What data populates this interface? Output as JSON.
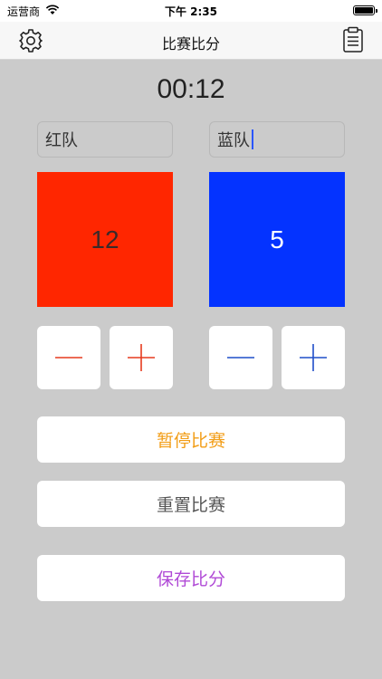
{
  "status_bar": {
    "carrier": "运营商",
    "time": "下午 2:35",
    "battery_level": 1.0
  },
  "nav": {
    "title": "比赛比分",
    "left_icon": "gear-icon",
    "right_icon": "clipboard-icon"
  },
  "timer": "00:12",
  "teams": {
    "red": {
      "name": "红队",
      "score": "12",
      "color": "#ff2600",
      "control_color": "#e63a1e"
    },
    "blue": {
      "name": "蓝队",
      "score": "5",
      "color": "#0433ff",
      "control_color": "#1f4ec9"
    }
  },
  "actions": {
    "pause": {
      "label": "暂停比赛",
      "color": "#f29d16"
    },
    "reset": {
      "label": "重置比赛",
      "color": "#555555"
    },
    "save": {
      "label": "保存比分",
      "color": "#b04ad6"
    }
  }
}
